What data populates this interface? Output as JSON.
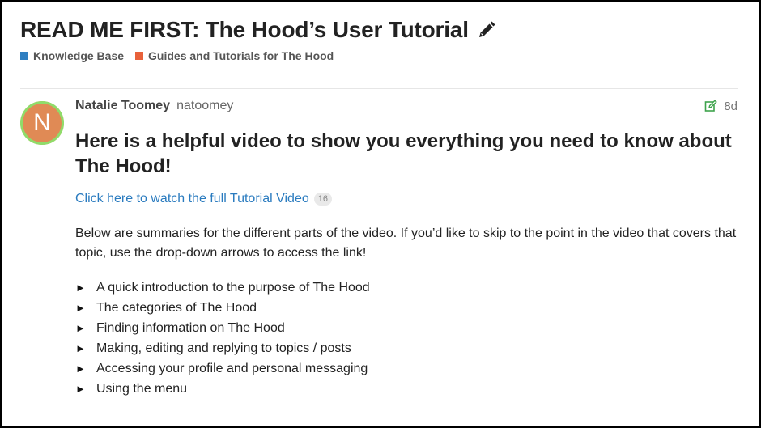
{
  "topic": {
    "title": "READ ME FIRST: The Hood’s User Tutorial",
    "categories": [
      {
        "label": "Knowledge Base",
        "color": "#2f7fc1"
      },
      {
        "label": "Guides and Tutorials for The Hood",
        "color": "#e8613a"
      }
    ]
  },
  "post": {
    "avatar_letter": "N",
    "author_name": "Natalie Toomey",
    "author_username": "natoomey",
    "age": "8d",
    "heading": "Here is a helpful video to show you everything you need to know about The Hood!",
    "video_link": "Click here to watch the full Tutorial Video",
    "video_link_clicks": "16",
    "paragraph": "Below are summaries for the different parts of the video. If you’d like to skip to the point in the video that covers that topic, use the drop-down arrows to access the link!",
    "sections": [
      "A quick introduction to the purpose of The Hood",
      "The categories of The Hood",
      "Finding information on The Hood",
      "Making, editing and replying to topics / posts",
      "Accessing your profile and personal messaging",
      "Using the menu"
    ],
    "section_marker": "►"
  }
}
